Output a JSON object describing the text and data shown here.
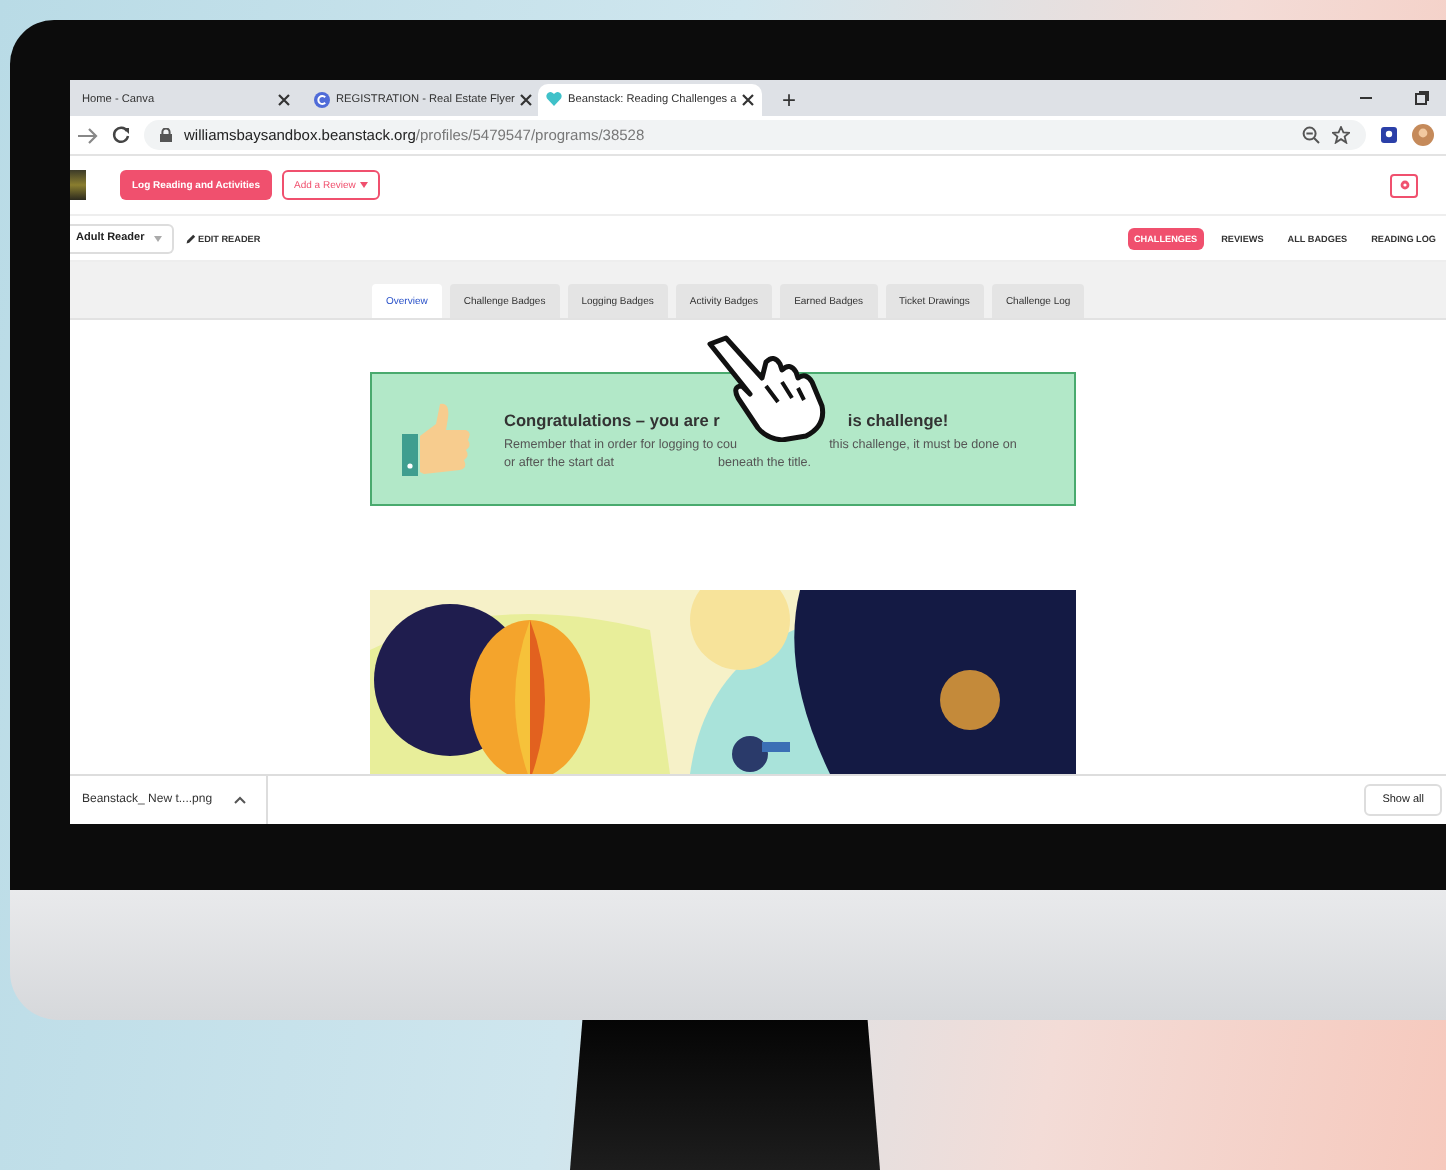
{
  "browser_tabs": [
    {
      "title": "Home - Canva",
      "kind": "plain",
      "selected": false
    },
    {
      "title": "REGISTRATION - Real Estate Flyer",
      "kind": "badge",
      "selected": false
    },
    {
      "title": "Beanstack: Reading Challenges a",
      "kind": "heart",
      "selected": true
    }
  ],
  "new_tab": "+",
  "address_bar": {
    "host": "williamsbaysandbox.beanstack.org",
    "path": "/profiles/5479547/programs/38528"
  },
  "header": {
    "primary_button": "Log Reading and Activities",
    "review_button": "Add a Review"
  },
  "reader_bar": {
    "reader": "Adult Reader",
    "edit": "EDIT READER",
    "nav": [
      {
        "label": "CHALLENGES",
        "selected": true
      },
      {
        "label": "REVIEWS",
        "selected": false
      },
      {
        "label": "ALL BADGES",
        "selected": false
      },
      {
        "label": "READING LOG",
        "selected": false
      }
    ]
  },
  "page_tabs": [
    {
      "label": "Overview",
      "selected": true
    },
    {
      "label": "Challenge Badges",
      "selected": false
    },
    {
      "label": "Logging Badges",
      "selected": false
    },
    {
      "label": "Activity Badges",
      "selected": false
    },
    {
      "label": "Earned Badges",
      "selected": false
    },
    {
      "label": "Ticket Drawings",
      "selected": false
    },
    {
      "label": "Challenge Log",
      "selected": false
    }
  ],
  "message": {
    "heading": [
      "Congratulations – you are r",
      "is challenge!"
    ],
    "lines": [
      [
        "Remember that in order for logging to cou",
        "this challenge, it must be done on"
      ],
      [
        "or after the start dat",
        "beneath the title."
      ]
    ]
  },
  "download_bar": {
    "file": "Beanstack_ New t....png",
    "button": "Show all"
  }
}
